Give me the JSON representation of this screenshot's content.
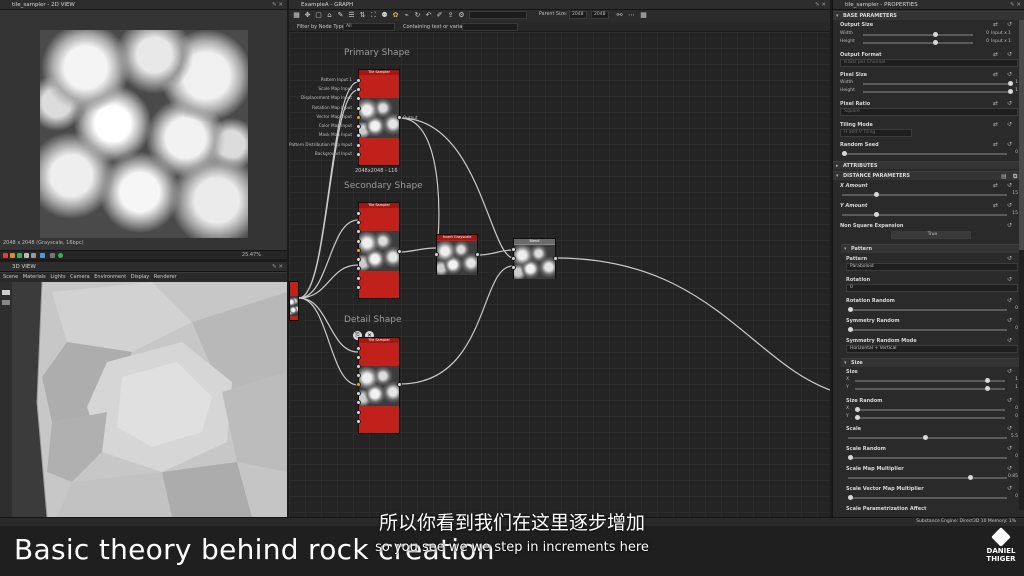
{
  "colors": {
    "node_red": "#c0211b",
    "pin_orange": "#e8a13a",
    "panel_bg": "#2a2a2a",
    "graph_bg": "#242424"
  },
  "view2d": {
    "title": "tile_sampler - 2D VIEW",
    "status": "2048 x 2048 (Grayscale, 16bpc)",
    "zoom": "25.47%"
  },
  "view3d": {
    "title": "3D VIEW",
    "menu": [
      "Scene",
      "Materials",
      "Lights",
      "Camera",
      "Environment",
      "Display",
      "Renderer"
    ]
  },
  "graph": {
    "title": "ExampleA - GRAPH",
    "filter_label": "Filter by Node Type",
    "filter_value": "All",
    "search_placeholder": "Containing text or variable",
    "parent_size_label": "Parent Size:",
    "parent_size_w": "2048",
    "parent_size_h": "2048",
    "frames": {
      "primary": "Primary Shape",
      "secondary": "Secondary Shape",
      "detail": "Detail Shape"
    },
    "primary_node": {
      "title": "Tile Sampler",
      "size_label": "2048x2048 - L16",
      "output_label": "Output",
      "inputs": [
        "Pattern Input 1",
        "Scale Map Input",
        "Displacement Map Input",
        "Rotation Map Input",
        "Vector Map Input",
        "Color Map Input",
        "Mask Map Input",
        "Pattern Distribution Map Input",
        "Background Input"
      ]
    },
    "secondary_node_title": "Tile Sampler",
    "detail_node_title": "Tile Sampler",
    "invert_node_title": "Invert Grayscale",
    "blend_node_title": "Blend"
  },
  "props": {
    "title": "tile_sampler - PROPERTIES",
    "sections": {
      "base": "BASE PARAMETERS",
      "attributes": "ATTRIBUTES",
      "distance": "DISTANCE PARAMETERS",
      "pattern": "Pattern",
      "size": "Size"
    },
    "output_size": {
      "label": "Output Size",
      "width_label": "Width",
      "width_value": "0",
      "width_mode": "Input x 1",
      "height_label": "Height",
      "height_value": "0",
      "height_mode": "Input x 1"
    },
    "output_format": {
      "label": "Output Format",
      "value": "8 bits per Channel"
    },
    "pixel_size": {
      "label": "Pixel Size",
      "width_label": "Width",
      "width_value": "1",
      "height_label": "Height",
      "height_value": "1"
    },
    "pixel_ratio": {
      "label": "Pixel Ratio",
      "value": "Square"
    },
    "tiling_mode": {
      "label": "Tiling Mode",
      "value": "H and V Tiling"
    },
    "random_seed": {
      "label": "Random Seed",
      "value": "0"
    },
    "x_amount": {
      "label": "X Amount",
      "value": "15"
    },
    "y_amount": {
      "label": "Y Amount",
      "value": "15"
    },
    "non_square": {
      "label": "Non Square Expansion",
      "value": "True"
    },
    "pattern": {
      "label": "Pattern",
      "value": "Paraboloid"
    },
    "rotation": {
      "label": "Rotation",
      "value": "0"
    },
    "rotation_random": {
      "label": "Rotation Random",
      "value": "0"
    },
    "symmetry_random": {
      "label": "Symmetry Random",
      "value": "0"
    },
    "symmetry_random_mode": {
      "label": "Symmetry Random Mode",
      "value": "Horizontal + Vertical"
    },
    "size": {
      "label": "Size",
      "x_label": "X",
      "x_value": "1",
      "y_label": "Y",
      "y_value": "1"
    },
    "size_random": {
      "label": "Size Random",
      "x_label": "X",
      "x_value": "0",
      "y_label": "Y",
      "y_value": "0"
    },
    "scale": {
      "label": "Scale",
      "value": "5.5"
    },
    "scale_random": {
      "label": "Scale Random",
      "value": "0"
    },
    "scale_map_multiplier": {
      "label": "Scale Map Multiplier",
      "value": "0.85"
    },
    "scale_vector_map_multiplier": {
      "label": "Scale Vector Map Multiplier",
      "value": "0"
    },
    "scale_parametrization": {
      "label": "Scale Parametrization Affect"
    }
  },
  "statusbar": {
    "engine": "Substance Engine: Direct3D 10   Memory: 1%"
  },
  "overlay": {
    "title": "Basic theory behind rock creation",
    "subtitle_cn": "所以你看到我们在这里逐步增加",
    "subtitle_en": "so you see we we step in increments here",
    "logo_line1": "DANIEL",
    "logo_line2": "THIGER"
  }
}
